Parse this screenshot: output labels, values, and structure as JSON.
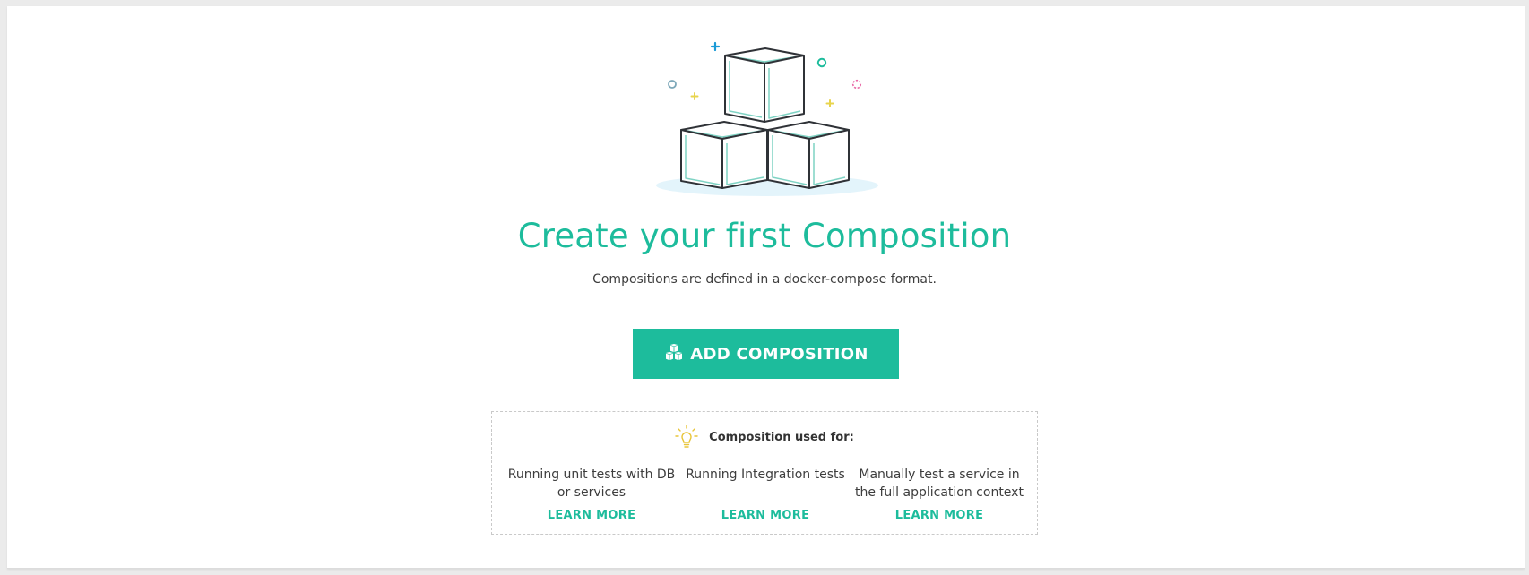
{
  "empty_state": {
    "title": "Create your first Composition",
    "subtitle": "Compositions are defined in a docker-compose format.",
    "illustration_icon": "stacked-cubes-illustration"
  },
  "primary_action": {
    "label": "ADD COMPOSITION",
    "icon": "cubes-icon"
  },
  "tips": {
    "icon": "lightbulb-icon",
    "title": "Composition used for:",
    "items": [
      {
        "text": "Running unit tests with DB or services",
        "link": "LEARN MORE"
      },
      {
        "text": "Running Integration tests",
        "link": "LEARN MORE"
      },
      {
        "text": "Manually test a service in the full application context",
        "link": "LEARN MORE"
      }
    ]
  },
  "colors": {
    "accent": "#1dbc9c",
    "text": "#3d3d3d",
    "background": "#ebebeb",
    "card": "#ffffff"
  }
}
